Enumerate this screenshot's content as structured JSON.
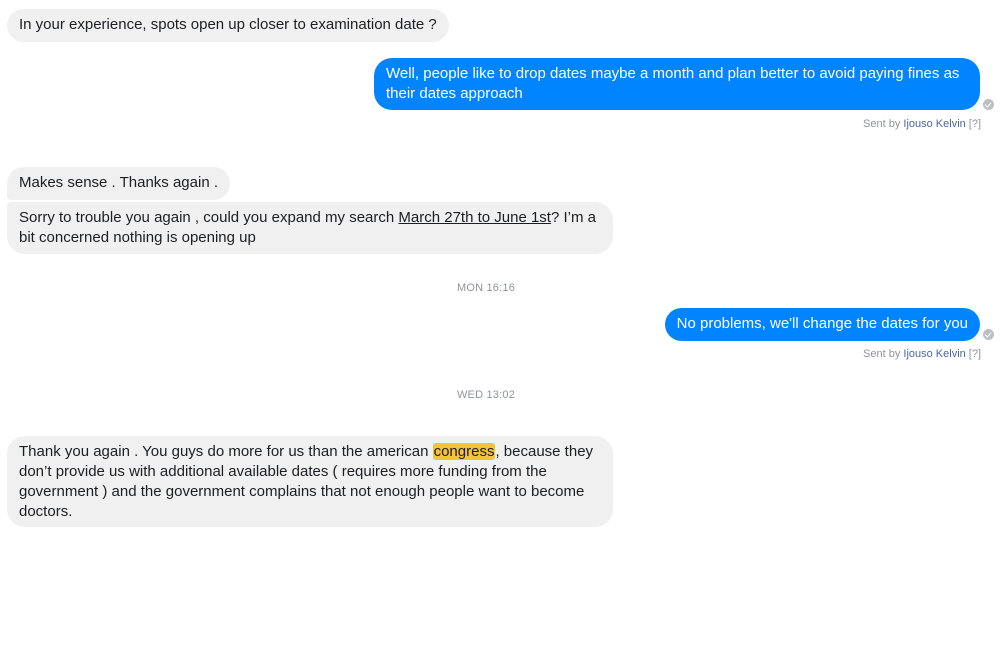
{
  "messages": {
    "m1": {
      "text": "In your experience, spots open up closer to examination date ?"
    },
    "m2": {
      "text": "Well, people like to drop dates maybe a month and plan better to avoid paying fines as their dates approach"
    },
    "m2_sent": {
      "prefix": "Sent by",
      "author": "Ijouso Kelvin",
      "help": "[?]"
    },
    "m3": {
      "text": "Makes sense . Thanks again ."
    },
    "m4": {
      "before": "Sorry to trouble you again , could you expand my search ",
      "link": "March 27th to June 1st",
      "after": "? I’m a bit concerned nothing is opening up"
    },
    "ts1": "MON 16:16",
    "m5": {
      "text": "No problems, we'll change the dates for you"
    },
    "m5_sent": {
      "prefix": "Sent by",
      "author": "Ijouso Kelvin",
      "help": "[?]"
    },
    "ts2": "WED 13:02",
    "m6": {
      "before": "Thank you again . You guys do more for us than the american ",
      "highlight": "congress",
      "after": ", because they don’t provide us with additional available dates ( requires more funding from the government ) and the government complains that not enough people want to become doctors."
    }
  },
  "colors": {
    "outgoing": "#0084ff",
    "incoming": "#f0f0f0",
    "highlight": "#f5c33b"
  },
  "icons": {
    "seen": "seen-check-icon"
  }
}
